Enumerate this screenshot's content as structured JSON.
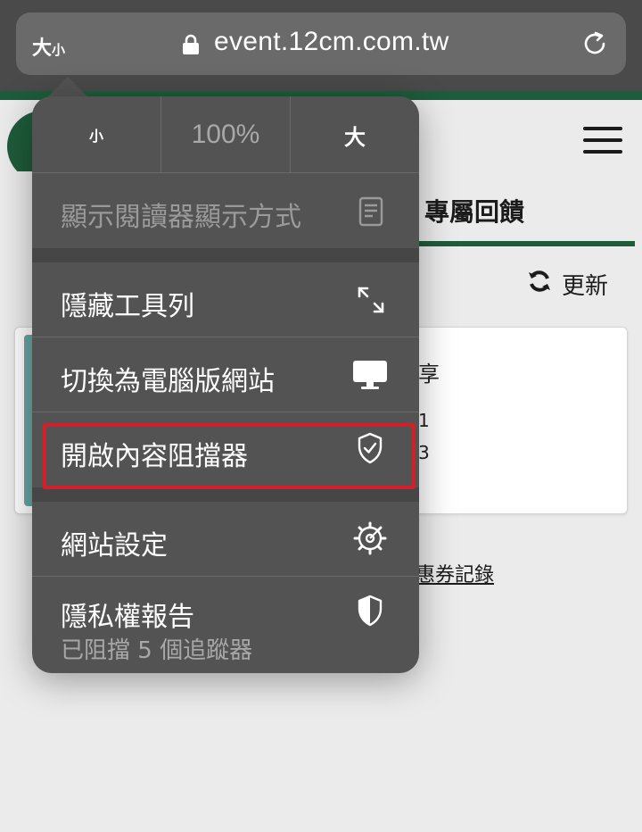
{
  "browser": {
    "text_size_big": "大",
    "text_size_small": "小",
    "url": "event.12cm.com.tw"
  },
  "page": {
    "tab_title": "專屬回饋",
    "refresh_label": "更新",
    "card_line1": "享",
    "card_line2": "1",
    "card_line3": "3",
    "coupon_link": "惠券記錄"
  },
  "menu": {
    "zoom_small": "小",
    "zoom_level": "100%",
    "zoom_big": "大",
    "items": [
      {
        "label": "顯示閱讀器顯示方式",
        "icon": "reader-icon",
        "enabled": false
      },
      {
        "label": "隱藏工具列",
        "icon": "expand-arrows-icon"
      },
      {
        "label": "切換為電腦版網站",
        "icon": "desktop-icon"
      },
      {
        "label": "開啟內容阻擋器",
        "icon": "shield-check-icon",
        "highlighted": true
      },
      {
        "label": "網站設定",
        "icon": "gear-icon"
      },
      {
        "label": "隱私權報告",
        "sublabel": "已阻擋 5 個追蹤器",
        "icon": "half-shield-icon"
      }
    ]
  },
  "colors": {
    "menu_bg": "#535353",
    "highlight": "#d21f2a",
    "brand_green": "#1e5c3b"
  }
}
